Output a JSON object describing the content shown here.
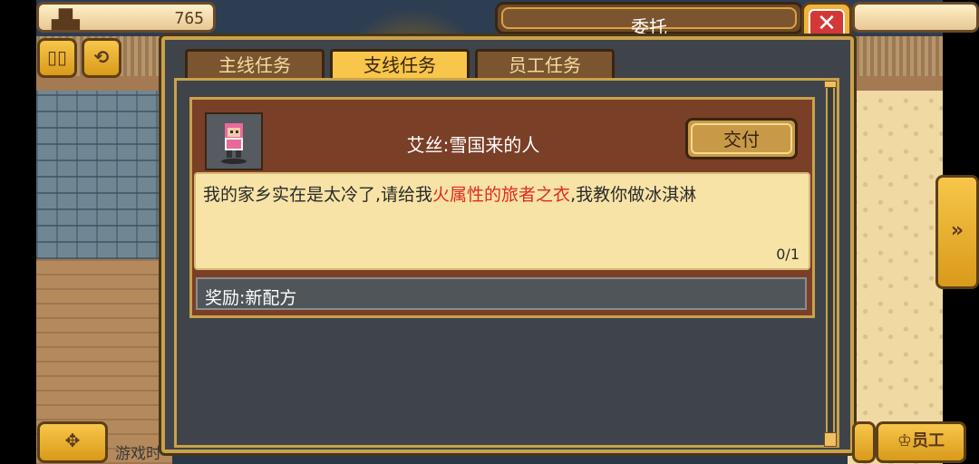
{
  "hud": {
    "funds_value": "765",
    "bottom_text": "游戏时",
    "staff_button": "员工"
  },
  "window": {
    "title": "委托",
    "close_glyph": "✕"
  },
  "tabs": [
    {
      "label": "主线任务",
      "active": false
    },
    {
      "label": "支线任务",
      "active": true
    },
    {
      "label": "员工任务",
      "active": false
    }
  ],
  "quest": {
    "name": "艾丝:雪国来的人",
    "deliver_label": "交付",
    "desc_prefix": "我的家乡实在是太冷了,请给我",
    "desc_highlight": "火属性的旅者之衣",
    "desc_suffix": ",我教你做冰淇淋",
    "progress": "0/1",
    "reward": "奖励:新配方"
  },
  "icons": {
    "funds": "building-chart-icon",
    "pause": "pause-icon",
    "swap": "swap-icon",
    "move": "move-icon",
    "expand": "double-arrow-right-icon",
    "staff": "staff-icon",
    "close": "close-icon"
  },
  "colors": {
    "accent_gold": "#f7c64a",
    "highlight_red": "#e02a20",
    "panel_dark": "#3f444a"
  }
}
